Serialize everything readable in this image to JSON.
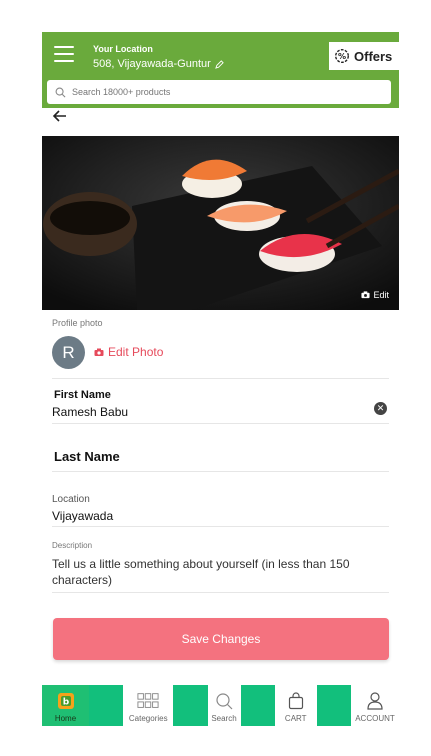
{
  "header": {
    "location_label": "Your Location",
    "location_value": "508, Vijayawada-Guntur",
    "offers_label": "Offers",
    "search_placeholder": "Search 18000+ products"
  },
  "hero": {
    "edit_label": "Edit"
  },
  "profile": {
    "photo_label": "Profile photo",
    "avatar_letter": "R",
    "edit_photo_label": "Edit Photo"
  },
  "form": {
    "first_name_label": "First Name",
    "first_name_value": "Ramesh Babu",
    "last_name_label": "Last Name",
    "location_label": "Location",
    "location_value": "Vijayawada",
    "description_label": "Description",
    "description_placeholder": "Tell us a little something about yourself (in less than 150 characters)",
    "save_label": "Save Changes"
  },
  "nav": {
    "items": [
      {
        "label": "Home",
        "icon": "home-logo-icon"
      },
      {
        "label": "Categories",
        "icon": "grid-icon"
      },
      {
        "label": "Search",
        "icon": "search-icon"
      },
      {
        "label": "CART",
        "icon": "cart-icon"
      },
      {
        "label": "ACCOUNT",
        "icon": "user-icon"
      }
    ]
  },
  "colors": {
    "header": "#6aaa3c",
    "accent": "#e64a5b",
    "save": "#f4727f",
    "nav": "#12bf7c"
  }
}
